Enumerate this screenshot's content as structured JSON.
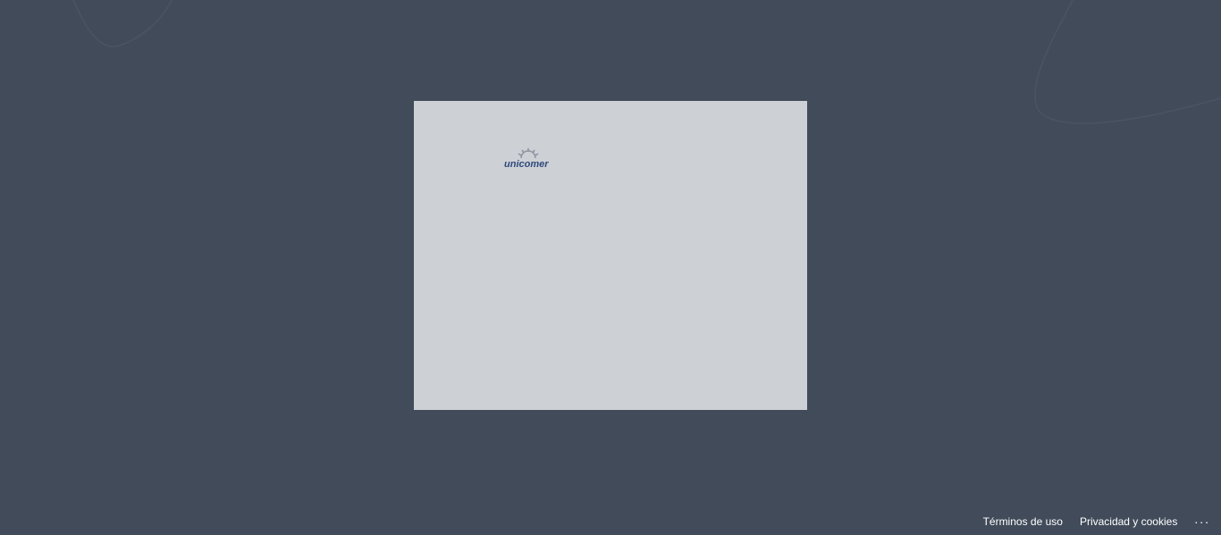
{
  "logo": {
    "text": "unicomer",
    "icon": "unicomer-logo"
  },
  "footer": {
    "terms_label": "Términos de uso",
    "privacy_label": "Privacidad y cookies",
    "more_label": "..."
  },
  "colors": {
    "background": "#414b5a",
    "card": "#cdd0d5",
    "logo_text": "#2f4a7c",
    "footer_text": "#ffffff"
  }
}
